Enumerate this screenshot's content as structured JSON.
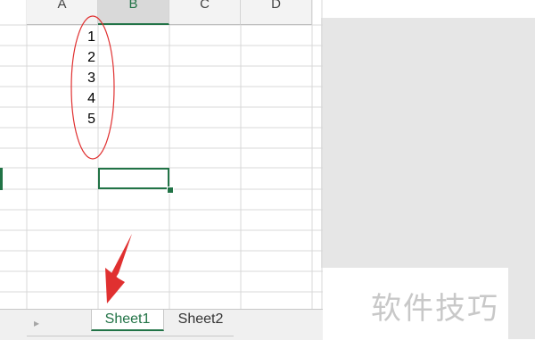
{
  "spreadsheet": {
    "columns": [
      "A",
      "B",
      "C",
      "D"
    ],
    "active_column": "B",
    "b_column_values": [
      "1",
      "2",
      "3",
      "4",
      "5"
    ],
    "selected_cell": "B8"
  },
  "tabs": {
    "prev_label": "◂",
    "next_label": "▸",
    "sheets": [
      {
        "label": "Sheet1",
        "active": true
      },
      {
        "label": "Sheet2",
        "active": false
      }
    ]
  },
  "watermark": "软件技巧",
  "colors": {
    "accent": "#217346",
    "annotation": "#e03030",
    "background": "#e6e6e6"
  }
}
